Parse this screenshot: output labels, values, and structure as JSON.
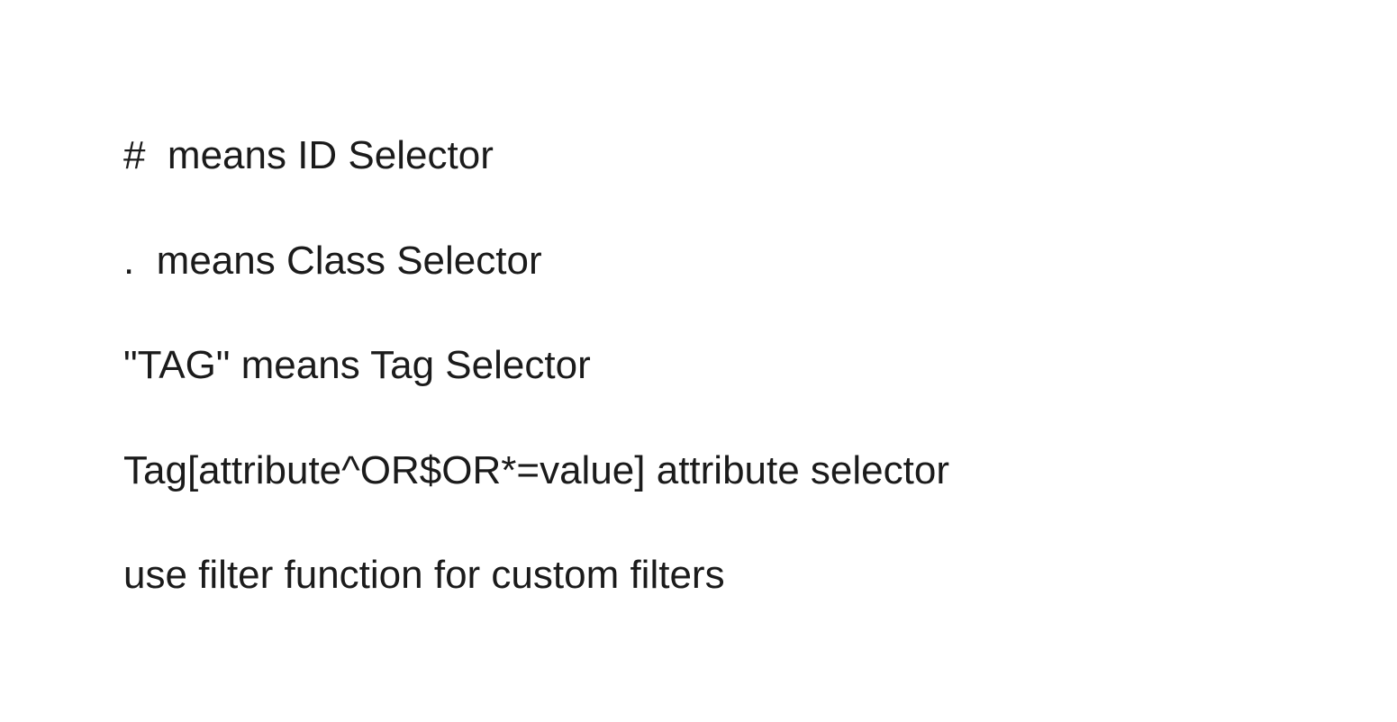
{
  "lines": [
    "#  means ID Selector",
    ".  means Class Selector",
    "\"TAG\" means Tag Selector",
    "Tag[attribute^OR$OR*=value] attribute selector",
    "use filter function for custom filters"
  ]
}
